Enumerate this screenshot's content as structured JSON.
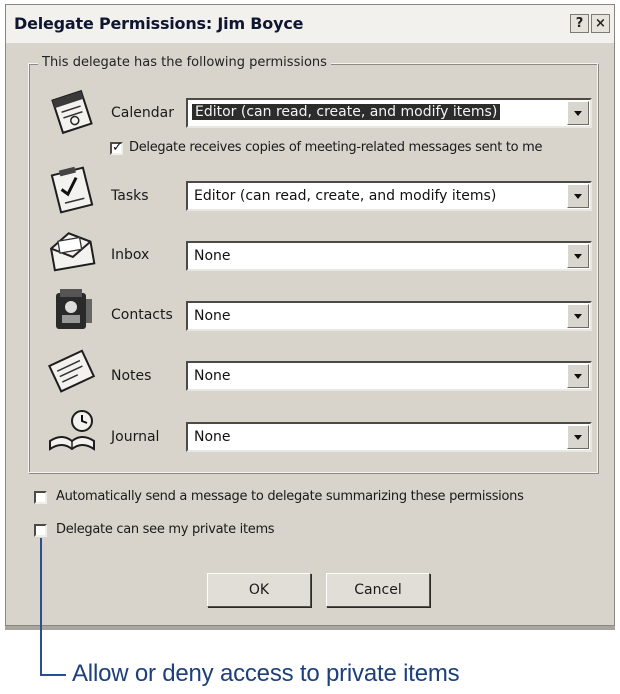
{
  "window": {
    "title": "Delegate Permissions: Jim Boyce",
    "help_label": "?",
    "close_label": "×"
  },
  "permissions": {
    "group_label": "This delegate has the following permissions",
    "rows": [
      {
        "label": "Calendar",
        "value": "Editor (can read, create, and modify items)",
        "icon": "calendar-icon"
      },
      {
        "label": "Tasks",
        "value": "Editor (can read, create, and modify items)",
        "icon": "tasks-icon"
      },
      {
        "label": "Inbox",
        "value": "None",
        "icon": "inbox-icon"
      },
      {
        "label": "Contacts",
        "value": "None",
        "icon": "contacts-icon"
      },
      {
        "label": "Notes",
        "value": "None",
        "icon": "notes-icon"
      },
      {
        "label": "Journal",
        "value": "None",
        "icon": "journal-icon"
      }
    ],
    "meeting_copies": {
      "label": "Delegate receives copies of meeting-related messages sent to me",
      "checked": true
    }
  },
  "options": {
    "summary_message": {
      "label": "Automatically send a message to delegate summarizing these permissions",
      "checked": false
    },
    "private_items": {
      "label": "Delegate can see my private items",
      "checked": false
    }
  },
  "buttons": {
    "ok_label": "OK",
    "cancel_label": "Cancel"
  },
  "annotation": {
    "text": "Allow or deny access to private items",
    "color": "#27508f"
  }
}
